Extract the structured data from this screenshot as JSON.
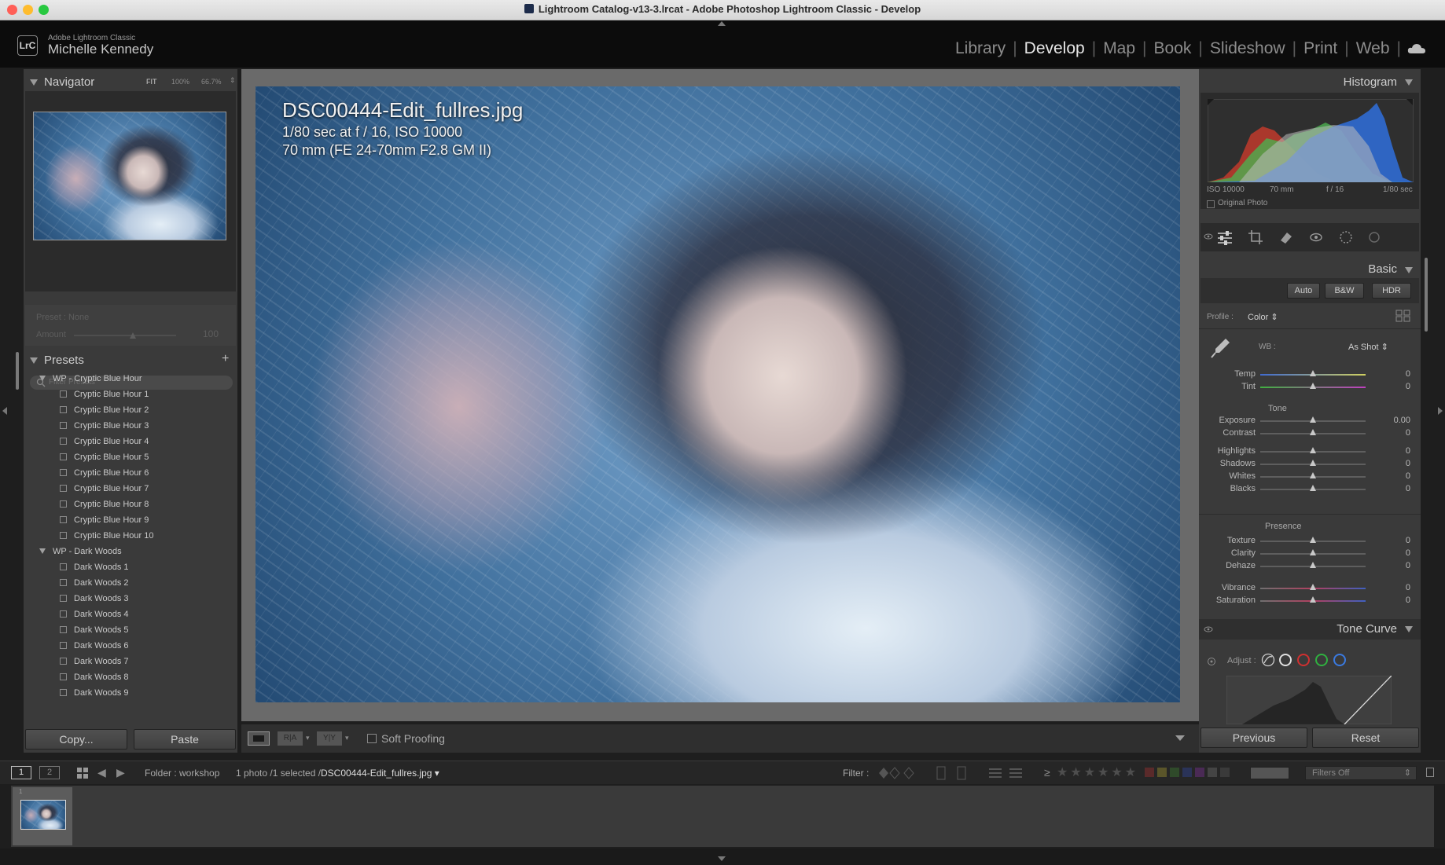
{
  "window": {
    "title": "Lightroom Catalog-v13-3.lrcat - Adobe Photoshop Lightroom Classic - Develop"
  },
  "identity": {
    "logo_text": "LrC",
    "app_name": "Adobe Lightroom Classic",
    "user_name": "Michelle Kennedy"
  },
  "modules": [
    "Library",
    "Develop",
    "Map",
    "Book",
    "Slideshow",
    "Print",
    "Web"
  ],
  "active_module": "Develop",
  "navigator": {
    "title": "Navigator",
    "zoom_options": [
      "FIT",
      "100%",
      "66.7%"
    ]
  },
  "preset_amount": {
    "preset_label": "Preset : None",
    "amount_label": "Amount",
    "amount_value": "100"
  },
  "presets": {
    "title": "Presets",
    "filter_placeholder": "Filter Presets",
    "groups": [
      {
        "name": "WP - Cryptic Blue Hour",
        "items": [
          "Cryptic Blue Hour 1",
          "Cryptic Blue Hour 2",
          "Cryptic Blue Hour 3",
          "Cryptic Blue Hour 4",
          "Cryptic Blue Hour 5",
          "Cryptic Blue Hour 6",
          "Cryptic Blue Hour 7",
          "Cryptic Blue Hour 8",
          "Cryptic Blue Hour 9",
          "Cryptic Blue Hour 10"
        ]
      },
      {
        "name": "WP - Dark Woods",
        "items": [
          "Dark Woods 1",
          "Dark Woods 2",
          "Dark Woods 3",
          "Dark Woods 4",
          "Dark Woods 5",
          "Dark Woods 6",
          "Dark Woods 7",
          "Dark Woods 8",
          "Dark Woods 9"
        ]
      }
    ]
  },
  "left_buttons": {
    "copy": "Copy...",
    "paste": "Paste"
  },
  "photo": {
    "filename": "DSC00444-Edit_fullres.jpg",
    "exposure_info": "1/80 sec at f / 16, ISO 10000",
    "lens_info": "70 mm (FE 24-70mm F2.8 GM II)"
  },
  "toolbar": {
    "soft_proofing": "Soft Proofing"
  },
  "histogram": {
    "title": "Histogram",
    "iso": "ISO 10000",
    "focal": "70 mm",
    "aperture": "f / 16",
    "shutter": "1/80 sec",
    "original_photo": "Original Photo"
  },
  "basic": {
    "title": "Basic",
    "buttons": [
      "Auto",
      "B&W",
      "HDR"
    ],
    "profile_label": "Profile :",
    "profile_value": "Color",
    "wb_label": "WB :",
    "wb_value": "As Shot",
    "wb_sliders": [
      {
        "label": "Temp",
        "value": "0"
      },
      {
        "label": "Tint",
        "value": "0"
      }
    ],
    "tone_label": "Tone",
    "tone_sliders": [
      {
        "label": "Exposure",
        "value": "0.00"
      },
      {
        "label": "Contrast",
        "value": "0"
      },
      {
        "label": "Highlights",
        "value": "0"
      },
      {
        "label": "Shadows",
        "value": "0"
      },
      {
        "label": "Whites",
        "value": "0"
      },
      {
        "label": "Blacks",
        "value": "0"
      }
    ],
    "presence_label": "Presence",
    "presence_sliders": [
      {
        "label": "Texture",
        "value": "0"
      },
      {
        "label": "Clarity",
        "value": "0"
      },
      {
        "label": "Dehaze",
        "value": "0"
      },
      {
        "label": "Vibrance",
        "value": "0"
      },
      {
        "label": "Saturation",
        "value": "0"
      }
    ]
  },
  "tone_curve": {
    "title": "Tone Curve",
    "adjust_label": "Adjust :"
  },
  "right_buttons": {
    "previous": "Previous",
    "reset": "Reset"
  },
  "filterbar": {
    "screen1": "1",
    "screen2": "2",
    "folder": "Folder : workshop",
    "selection": "1 photo /1 selected /",
    "selected_file": "DSC00444-Edit_fullres.jpg",
    "filter_label": "Filter :",
    "filters_value": "Filters Off"
  },
  "filmstrip": {
    "index": "1"
  }
}
